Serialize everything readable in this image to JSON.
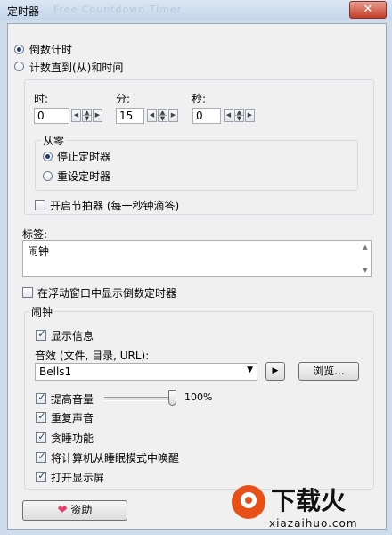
{
  "window": {
    "title": "定时器",
    "blurred_title": "Free Countdown Timer",
    "close_symbol": "✕"
  },
  "mode": {
    "countdown_label": "倒数计时",
    "countup_label": "计数直到(从)和时间",
    "selected": "countdown"
  },
  "time": {
    "hours_label": "时:",
    "hours_value": "0",
    "minutes_label": "分:",
    "minutes_value": "15",
    "seconds_label": "秒:",
    "seconds_value": "0"
  },
  "from_zero": {
    "group_label": "从零",
    "stop_label": "停止定时器",
    "reset_label": "重设定时器",
    "selected": "stop"
  },
  "metronome": {
    "label": "开启节拍器 (每一秒钟滴答)",
    "checked": false
  },
  "tag": {
    "label": "标签:",
    "value": "闹钟"
  },
  "float_window": {
    "label": "在浮动窗口中显示倒数定时器",
    "checked": false
  },
  "alarm": {
    "group_label": "闹钟",
    "show_message": {
      "label": "显示信息",
      "checked": true
    },
    "sound_label": "音效 (文件, 目录, URL):",
    "sound_value": "Bells1",
    "play_symbol": "▶",
    "browse_label": "浏览...",
    "volume_boost": {
      "label": "提高音量",
      "checked": true
    },
    "volume_percent": "100%",
    "volume_level": 1.0,
    "repeat_sound": {
      "label": "重复声音",
      "checked": true
    },
    "snooze": {
      "label": "贪睡功能",
      "checked": true
    },
    "wake_computer": {
      "label": "将计算机从睡眠模式中唤醒",
      "checked": true
    },
    "turn_on_display": {
      "label": "打开显示屏",
      "checked": true
    }
  },
  "donate": {
    "label": "资助",
    "icon": "heart-icon"
  },
  "watermark": {
    "brand": "下载火",
    "url": "xiazaihuo.com"
  },
  "colors": {
    "accent": "#1d3c6e",
    "close": "#c43d26",
    "heart": "#e0406a",
    "brand": "#e8501a"
  }
}
